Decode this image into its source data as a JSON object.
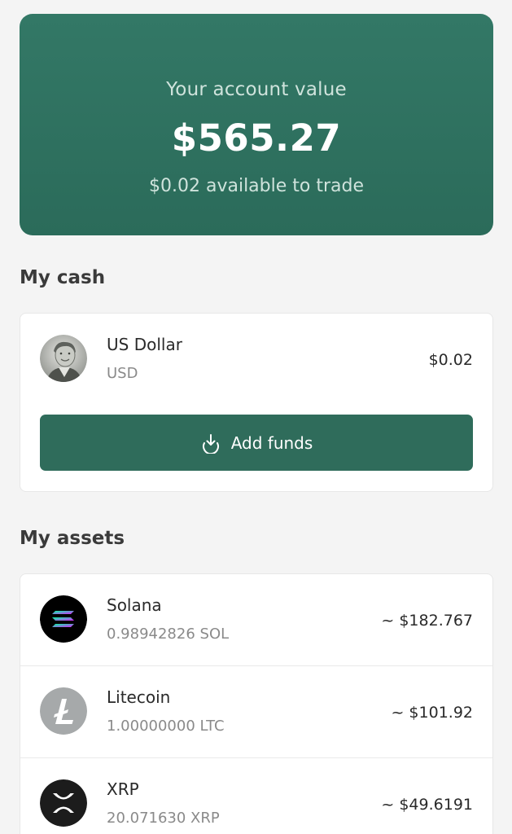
{
  "summary": {
    "label": "Your account value",
    "amount": "$565.27",
    "available": "$0.02 available to trade"
  },
  "cash": {
    "title": "My cash",
    "item": {
      "name": "US Dollar",
      "code": "USD",
      "value": "$0.02",
      "icon": "dollar-bill-portrait-icon"
    },
    "add_funds_label": "Add funds",
    "add_funds_icon": "download-icon"
  },
  "assets": {
    "title": "My assets",
    "items": [
      {
        "name": "Solana",
        "amount": "0.98942826 SOL",
        "value": "~ $182.767",
        "icon": "solana-icon"
      },
      {
        "name": "Litecoin",
        "amount": "1.00000000 LTC",
        "value": "~ $101.92",
        "icon": "litecoin-icon"
      },
      {
        "name": "XRP",
        "amount": "20.071630 XRP",
        "value": "~ $49.6191",
        "icon": "xrp-icon"
      }
    ]
  },
  "colors": {
    "brand": "#2f6c5b",
    "background": "#f4f4f4"
  }
}
